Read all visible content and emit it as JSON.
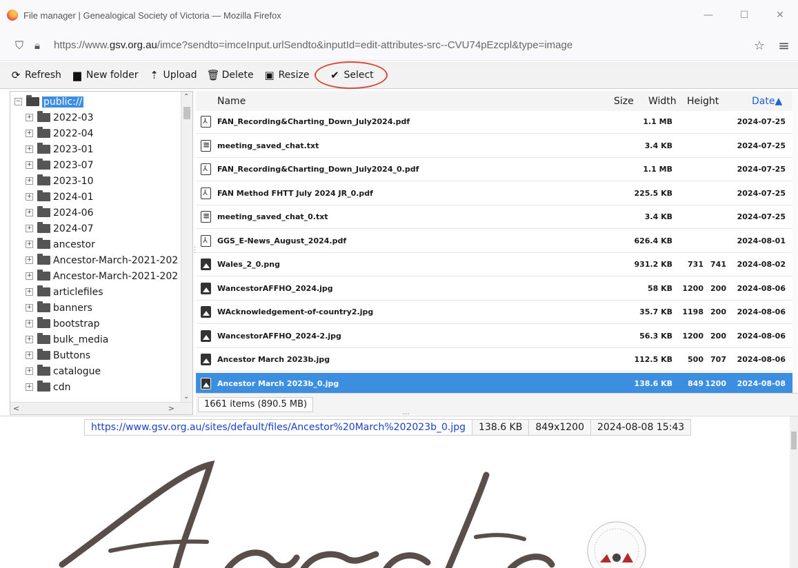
{
  "window": {
    "title": "File manager | Genealogical Society of Victoria — Mozilla Firefox",
    "controls": {
      "minimize": "—",
      "maximize": "☐",
      "close": "✕"
    }
  },
  "urlbar": {
    "scheme": "https://www.",
    "host": "gsv.org.au",
    "path": "/imce?sendto=imceInput.urlSendto&inputId=edit-attributes-src--CVU74pEzcpl&type=image"
  },
  "toolbar": {
    "refresh": "Refresh",
    "new_folder": "New folder",
    "upload": "Upload",
    "delete": "Delete",
    "resize": "Resize",
    "select": "Select"
  },
  "tree": {
    "root": "public://",
    "folders": [
      "2022-03",
      "2022-04",
      "2023-01",
      "2023-07",
      "2023-10",
      "2024-01",
      "2024-06",
      "2024-07",
      "ancestor",
      "Ancestor-March-2021-202",
      "Ancestor-March-2021-202",
      "articlefiles",
      "banners",
      "bootstrap",
      "bulk_media",
      "Buttons",
      "catalogue",
      "cdn"
    ]
  },
  "filelist": {
    "columns": {
      "name": "Name",
      "size": "Size",
      "width": "Width",
      "height": "Height",
      "date": "Date▲"
    },
    "rows": [
      {
        "type": "pdf",
        "name": "FAN_Recording&Charting_Down_July2024.pdf",
        "size": "1.1 MB",
        "width": "",
        "height": "",
        "date": "2024-07-25"
      },
      {
        "type": "txt",
        "name": "meeting_saved_chat.txt",
        "size": "3.4 KB",
        "width": "",
        "height": "",
        "date": "2024-07-25"
      },
      {
        "type": "pdf",
        "name": "FAN_Recording&Charting_Down_July2024_0.pdf",
        "size": "1.1 MB",
        "width": "",
        "height": "",
        "date": "2024-07-25"
      },
      {
        "type": "pdf",
        "name": "FAN Method FHTT July 2024 JR_0.pdf",
        "size": "225.5 KB",
        "width": "",
        "height": "",
        "date": "2024-07-25"
      },
      {
        "type": "txt",
        "name": "meeting_saved_chat_0.txt",
        "size": "3.4 KB",
        "width": "",
        "height": "",
        "date": "2024-07-25"
      },
      {
        "type": "pdf",
        "name": "GGS_E-News_August_2024.pdf",
        "size": "626.4 KB",
        "width": "",
        "height": "",
        "date": "2024-08-01"
      },
      {
        "type": "img",
        "name": "Wales_2_0.png",
        "size": "931.2 KB",
        "width": "731",
        "height": "741",
        "date": "2024-08-02"
      },
      {
        "type": "img",
        "name": "WancestorAFFHO_2024.jpg",
        "size": "58 KB",
        "width": "1200",
        "height": "200",
        "date": "2024-08-06"
      },
      {
        "type": "img",
        "name": "WAcknowledgement-of-country2.jpg",
        "size": "35.7 KB",
        "width": "1198",
        "height": "200",
        "date": "2024-08-06"
      },
      {
        "type": "img",
        "name": "WancestorAFFHO_2024-2.jpg",
        "size": "56.3 KB",
        "width": "1200",
        "height": "200",
        "date": "2024-08-06"
      },
      {
        "type": "img",
        "name": "Ancestor March 2023b.jpg",
        "size": "112.5 KB",
        "width": "500",
        "height": "707",
        "date": "2024-08-06"
      },
      {
        "type": "img",
        "name": "Ancestor March 2023b_0.jpg",
        "size": "138.6 KB",
        "width": "849",
        "height": "1200",
        "date": "2024-08-08",
        "selected": true
      }
    ],
    "status": "1661 items (890.5 MB)"
  },
  "preview": {
    "url": "https://www.gsv.org.au/sites/default/files/Ancestor%20March%202023b_0.jpg",
    "size": "138.6 KB",
    "dimensions": "849x1200",
    "datetime": "2024-08-08 15:43"
  }
}
